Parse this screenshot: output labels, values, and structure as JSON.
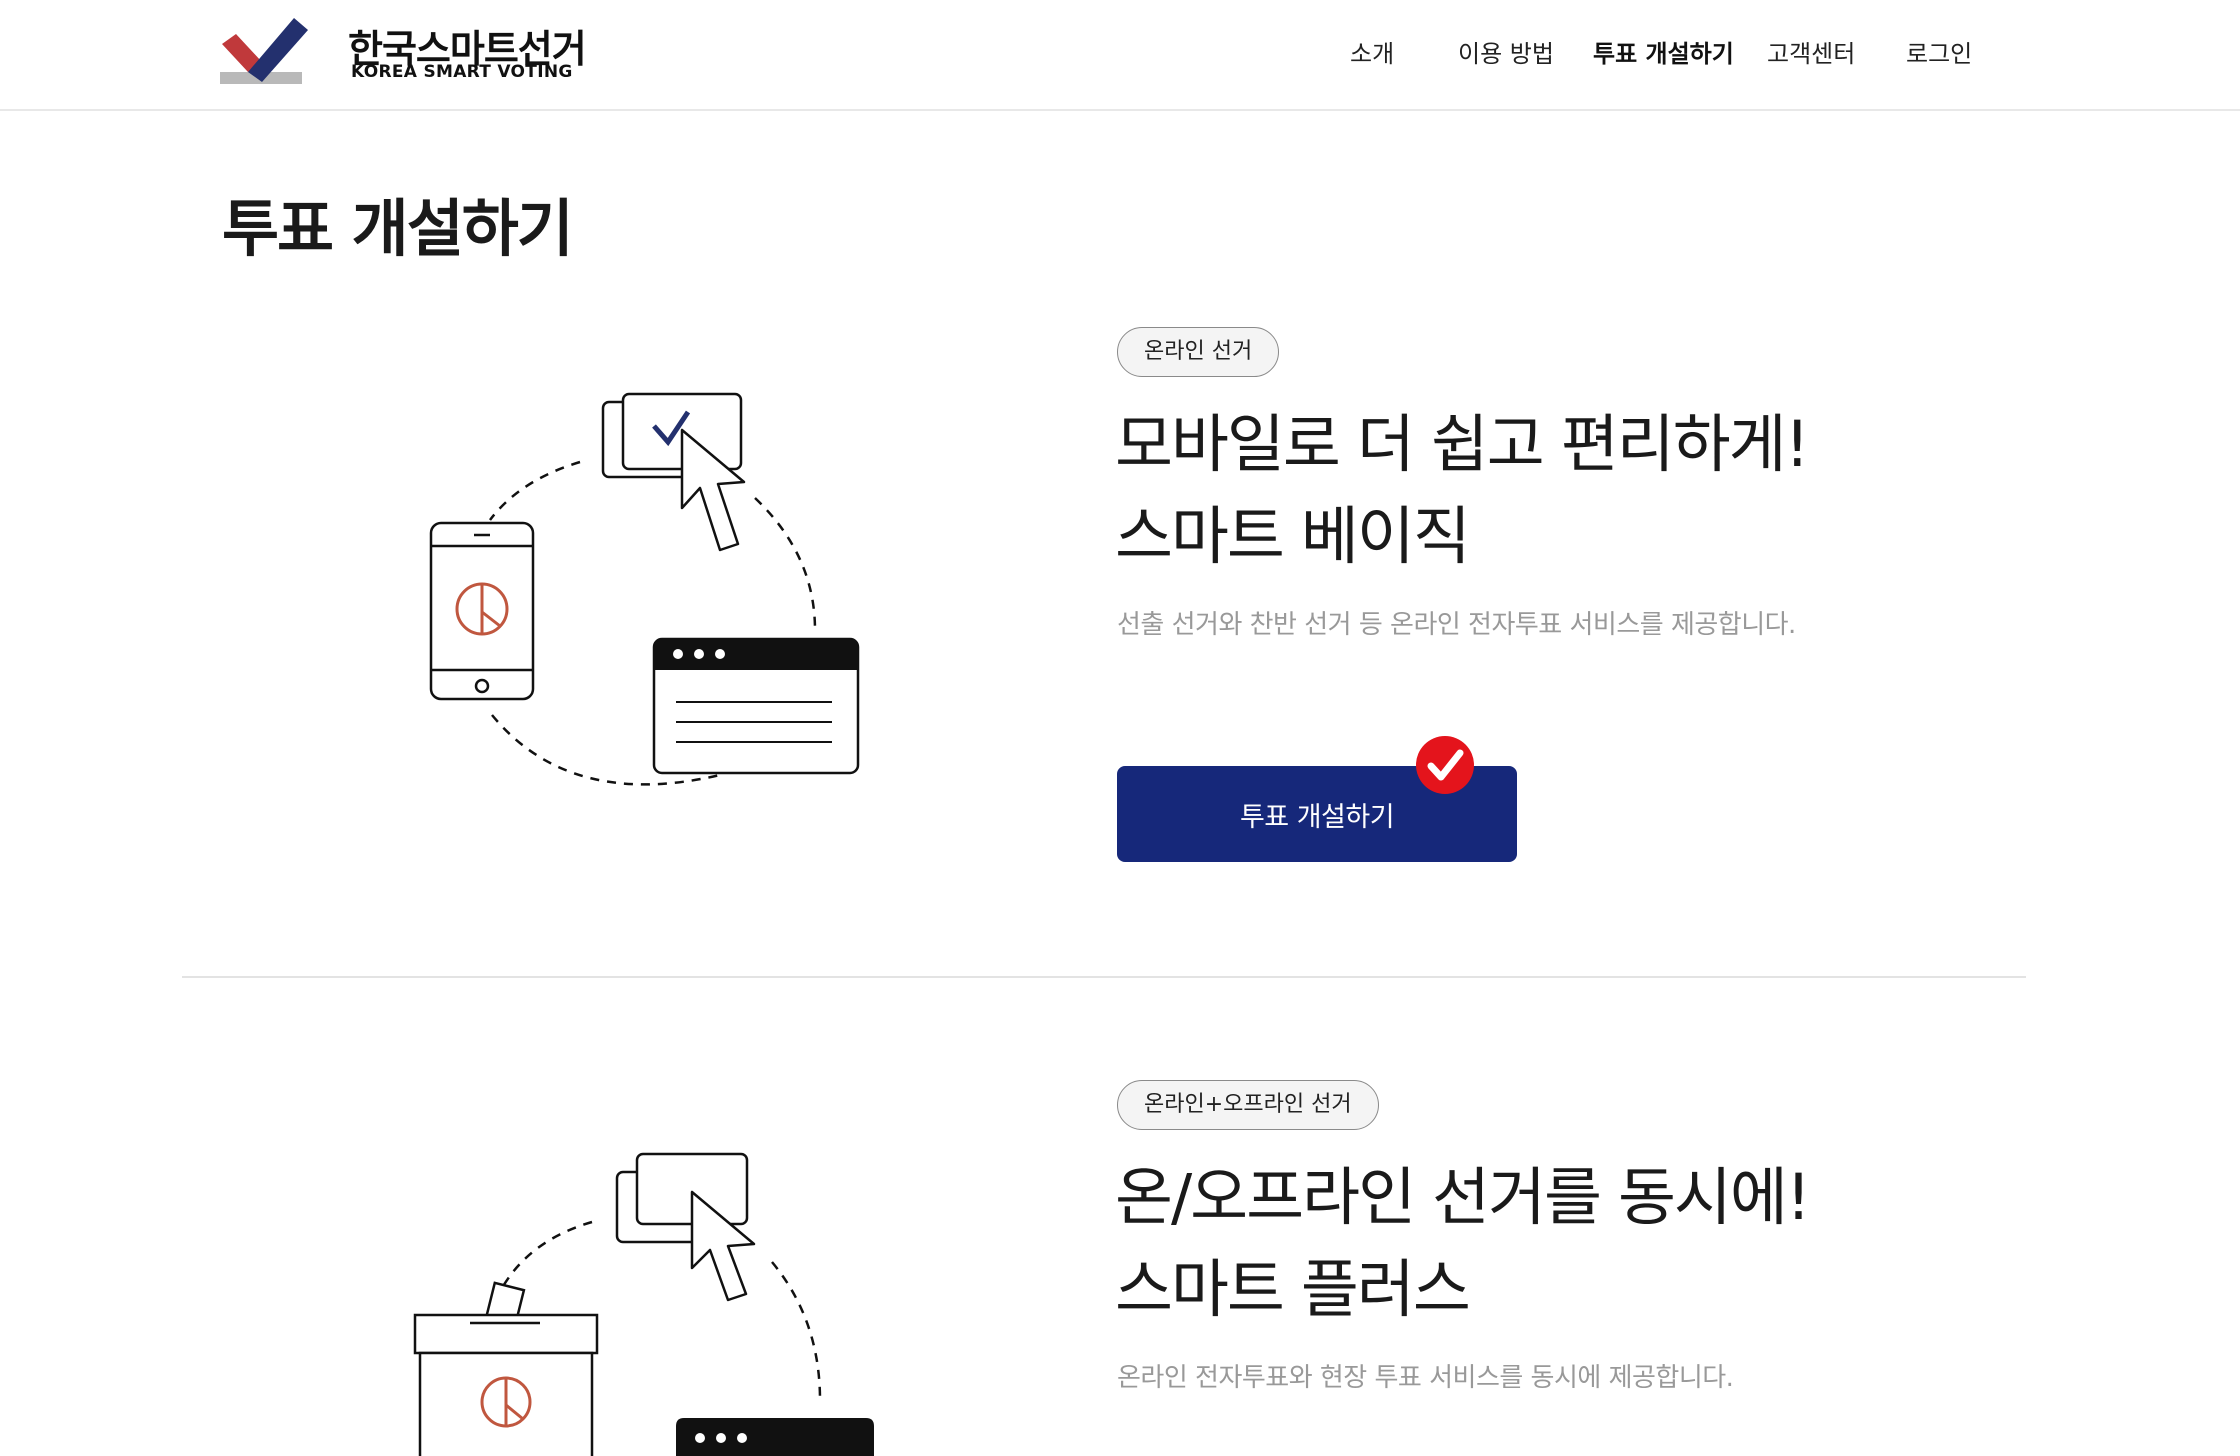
{
  "header": {
    "logo_title": "한국스마트선거",
    "logo_subtitle": "KOREA SMART VOTING",
    "nav": [
      "소개",
      "이용 방법",
      "투표 개설하기",
      "고객센터",
      "로그인"
    ],
    "active_nav": "투표 개설하기"
  },
  "page": {
    "title": "투표 개설하기"
  },
  "sections": [
    {
      "badge": "온라인 선거",
      "headline_line1": "모바일로 더 쉽고 편리하게!",
      "headline_line2": "스마트 베이직",
      "description": "선출 선거와 찬반 선거 등 온라인 전자투표 서비스를 제공합니다.",
      "button_label": "투표 개설하기"
    },
    {
      "badge": "온라인+오프라인 선거",
      "headline_line1": "온/오프라인 선거를 동시에!",
      "headline_line2": "스마트 플러스",
      "description": "온라인 전자투표와 현장 투표 서비스를 동시에 제공합니다."
    }
  ],
  "colors": {
    "brand_navy": "#16287a",
    "logo_red": "#c0393b",
    "logo_navy": "#23306e",
    "check_red": "#e4141c",
    "stamp_red": "#c0573f"
  },
  "icons": [
    "logo-mark",
    "phone-icon",
    "check-card-icon",
    "cursor-icon",
    "browser-window-icon",
    "ballot-box-icon",
    "check-badge-icon"
  ]
}
